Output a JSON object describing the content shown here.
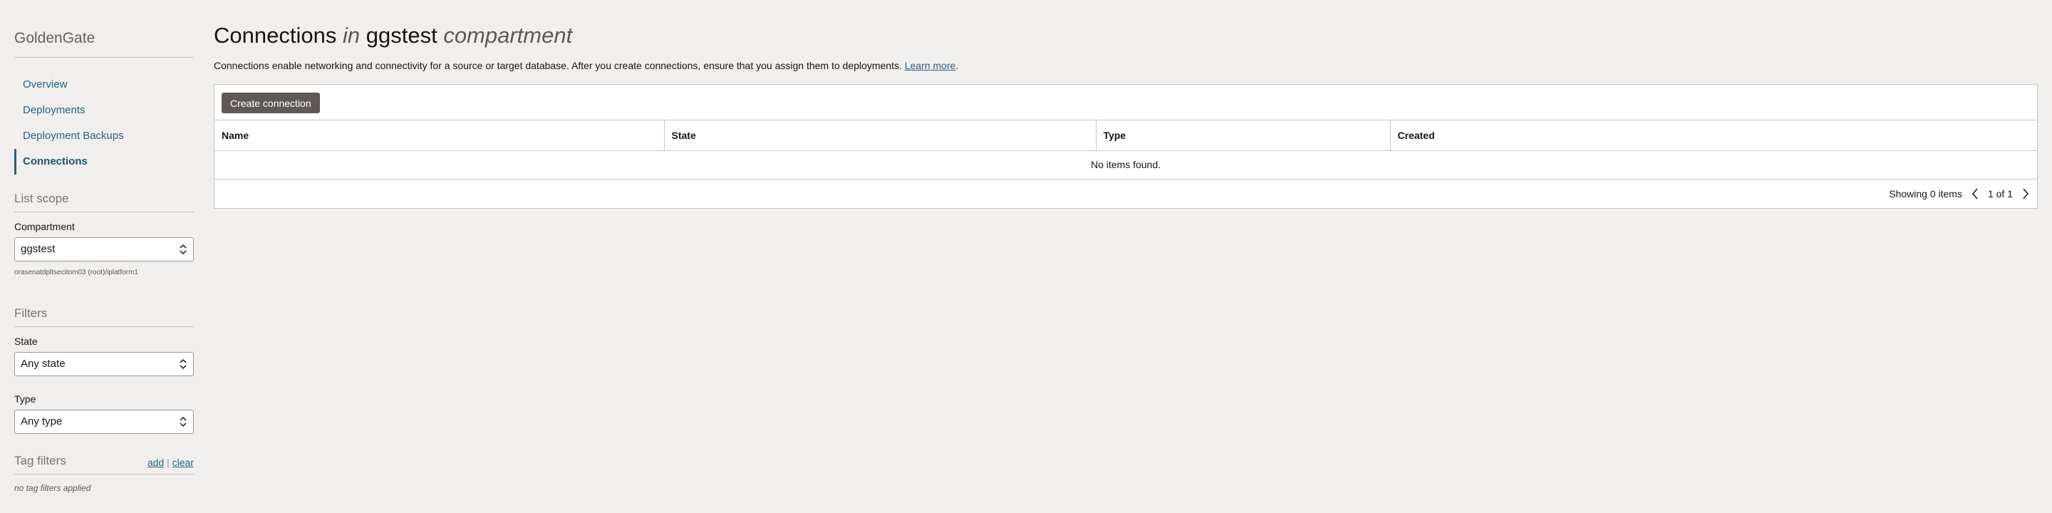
{
  "sidebar": {
    "brand": "GoldenGate",
    "nav": [
      {
        "label": "Overview",
        "active": false
      },
      {
        "label": "Deployments",
        "active": false
      },
      {
        "label": "Deployment Backups",
        "active": false
      },
      {
        "label": "Connections",
        "active": true
      }
    ],
    "list_scope": {
      "title": "List scope",
      "compartment_label": "Compartment",
      "compartment_value": "ggstest",
      "compartment_path": "orasenatdpltsecitom03 (root)/iplatform1"
    },
    "filters": {
      "title": "Filters",
      "state_label": "State",
      "state_value": "Any state",
      "type_label": "Type",
      "type_value": "Any type"
    },
    "tag_filters": {
      "title": "Tag filters",
      "add_label": "add",
      "separator": "|",
      "clear_label": "clear",
      "empty_text": "no tag filters applied"
    }
  },
  "main": {
    "title_prefix": "Connections",
    "title_in": "in",
    "title_compartment": "ggstest",
    "title_suffix": "compartment",
    "description": "Connections enable networking and connectivity for a source or target database. After you create connections, ensure that you assign them to deployments.",
    "learn_more": "Learn more",
    "description_end": ".",
    "create_button": "Create connection",
    "columns": [
      "Name",
      "State",
      "Type",
      "Created"
    ],
    "empty_text": "No items found.",
    "showing": "Showing 0 items",
    "page": "1 of 1"
  }
}
